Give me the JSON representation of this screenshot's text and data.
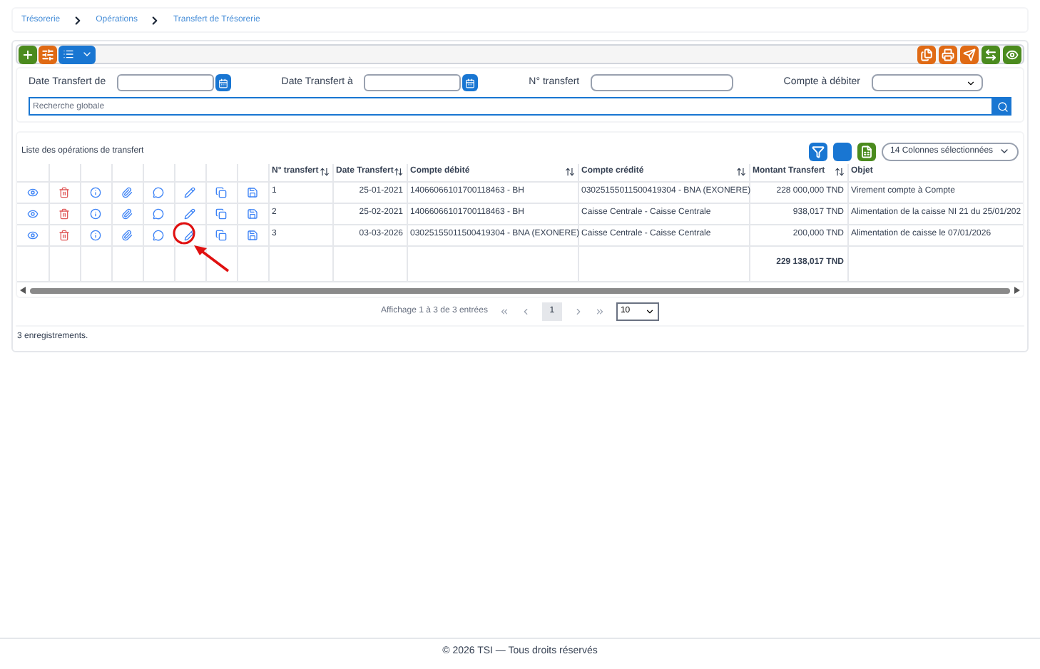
{
  "breadcrumb": [
    "Trésorerie",
    "Opérations",
    "Transfert de Trésorerie"
  ],
  "filters": [
    {
      "label": "Date Transfert de",
      "kind": "date"
    },
    {
      "label": "Date Transfert à",
      "kind": "date"
    },
    {
      "label": "N° transfert",
      "kind": "text"
    },
    {
      "label": "Compte à débiter",
      "kind": "select"
    }
  ],
  "search": {
    "placeholder": "Recherche globale"
  },
  "list": {
    "title": "Liste des opérations de transfert",
    "columns_select": "14 Colonnes sélectionnées",
    "columns": [
      "N° transfert",
      "Date Transfert",
      "Compte débité",
      "Compte crédité",
      "Montant Transfert",
      "Objet"
    ],
    "rows": [
      {
        "number": "1",
        "date": "25-01-2021",
        "debit": "14066066101700118463 - BH",
        "credit": "03025155011500419304 - BNA (EXONERE)",
        "amount": "228 000,000 TND",
        "object": "Virement compte à Compte"
      },
      {
        "number": "2",
        "date": "25-02-2021",
        "debit": "14066066101700118463 - BH",
        "credit": "Caisse Centrale - Caisse Centrale",
        "amount": "938,017 TND",
        "object": "Alimentation de la caisse NI 21 du 25/01/202"
      },
      {
        "number": "3",
        "date": "03-03-2026",
        "debit": "03025155011500419304 - BNA (EXONERE)",
        "credit": "Caisse Centrale - Caisse Centrale",
        "amount": "200,000 TND",
        "object": "Alimentation de caisse le 07/01/2026"
      }
    ],
    "total": "229 138,017 TND"
  },
  "pagination": {
    "summary": "Affichage 1 à 3 de 3 entrées",
    "pages": [
      {
        "label": "1",
        "selected": true
      }
    ],
    "page_size": "10"
  },
  "record_count": "3 enregistrements.",
  "footer": "© 2026 TSI — Tous droits réservés"
}
